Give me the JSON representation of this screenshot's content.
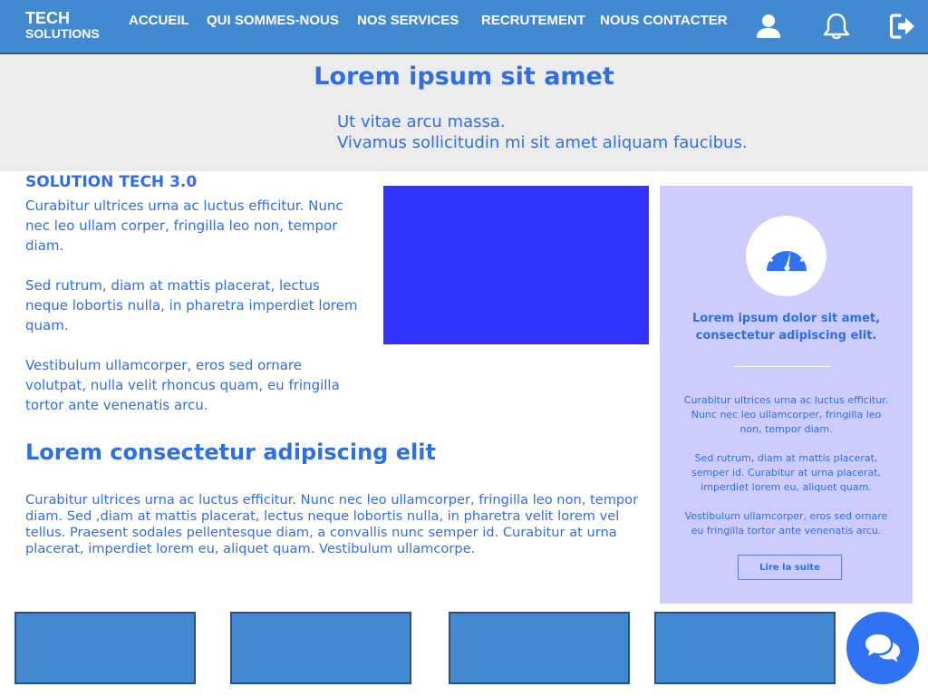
{
  "brand": {
    "line1": "TECH",
    "line2": "SOLUTIONS"
  },
  "nav": {
    "home": "ACCUEIL",
    "about": "QUI SOMMES-NOUS",
    "services": "NOS SERVICES",
    "careers": "RECRUTEMENT",
    "contact": "NOUS CONTACTER"
  },
  "header_icons": [
    "user-icon",
    "bell-icon",
    "logout-icon"
  ],
  "hero": {
    "title": "Lorem ipsum sit amet",
    "subtitle_line1": "Ut vitae arcu massa.",
    "subtitle_line2": "Vivamus sollicitudin mi sit amet aliquam faucibus."
  },
  "solution": {
    "title": "SOLUTION TECH 3.0",
    "paragraphs": [
      "Curabitur ultrices urna ac luctus efficitur. Nunc nec leo ullam corper, fringilla leo non, tempor diam.",
      "Sed rutrum, diam at mattis placerat, lectus neque lobortis nulla,  in pharetra  imperdiet lorem quam.",
      "Vestibulum ullamcorper, eros sed ornare volutpat, nulla velit rhoncus quam, eu fringilla tortor ante venenatis arcu."
    ]
  },
  "section2": {
    "title": "Lorem consectetur adipiscing elit",
    "text": "Curabitur ultrices urna ac luctus efficitur. Nunc nec leo ullamcorper, fringilla leo non, tempor diam. Sed ,diam at mattis placerat, lectus neque lobortis nulla, in pharetra velit lorem vel tellus. Praesent sodales pellentesque diam, a convallis nunc semper id. Curabitur at urna placerat, imperdiet lorem eu, aliquet quam. Vestibulum ullamcorpe."
  },
  "card": {
    "icon": "gauge-icon",
    "title": "Lorem ipsum dolor sit amet, consectetur adipiscing elit.",
    "paragraphs": [
      "Curabitur ultrices urna ac luctus efficitur. Nunc nec leo ullamcorper, fringilla leo non, tempor diam.",
      "Sed rutrum, diam at mattis placerat, semper id. Curabitur at urna placerat, imperdiet lorem eu, aliquet quam.",
      "Vestibulum ullamcorper, eros sed ornare eu fringilla tortor ante venenatis arcu."
    ],
    "button": "Lire la suite"
  },
  "chat_icon": "chat-bubbles-icon",
  "colors": {
    "header": "#4289d2",
    "accent_text": "#2f6fe0",
    "hero_bg": "#ececec",
    "media_block": "#3333ff",
    "card_bg": "#ccccff",
    "chat_button": "#2f72f2"
  }
}
